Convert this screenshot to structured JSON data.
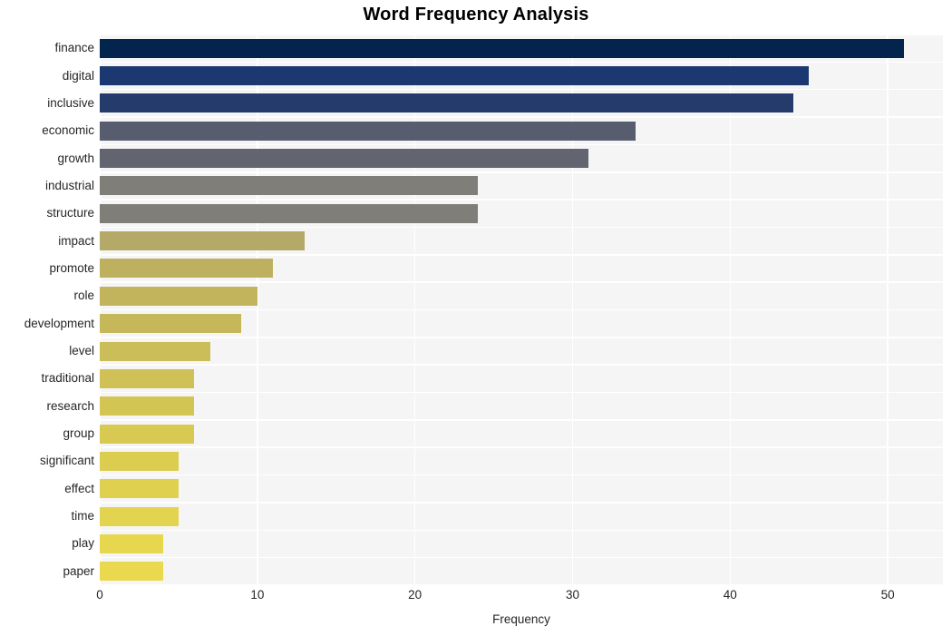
{
  "chart_data": {
    "type": "bar",
    "orientation": "horizontal",
    "title": "Word Frequency Analysis",
    "xlabel": "Frequency",
    "ylabel": "",
    "categories": [
      "finance",
      "digital",
      "inclusive",
      "economic",
      "growth",
      "industrial",
      "structure",
      "impact",
      "promote",
      "role",
      "development",
      "level",
      "traditional",
      "research",
      "group",
      "significant",
      "effect",
      "time",
      "play",
      "paper"
    ],
    "values": [
      51,
      45,
      44,
      34,
      31,
      24,
      24,
      13,
      11,
      10,
      9,
      7,
      6,
      6,
      6,
      5,
      5,
      5,
      4,
      4
    ],
    "bar_colors": [
      "#03244d",
      "#1b3870",
      "#243b6b",
      "#575c6e",
      "#62646f",
      "#807e78",
      "#807e78",
      "#b5a967",
      "#bdb05f",
      "#c2b45c",
      "#c6b85a",
      "#cbbd57",
      "#cfc155",
      "#d3c553",
      "#d7c951",
      "#dbcd50",
      "#dfd14f",
      "#e2d44e",
      "#e6d74e",
      "#ead94e"
    ],
    "xlim": [
      0,
      53.5
    ],
    "xticks": [
      0,
      10,
      20,
      30,
      40,
      50
    ],
    "xticklabels": [
      "0",
      "10",
      "20",
      "30",
      "40",
      "50"
    ],
    "grid": true,
    "grid_color": "#ffffff",
    "plot_background": "#f5f5f6",
    "figure_background": "#ffffff",
    "legend": null
  }
}
